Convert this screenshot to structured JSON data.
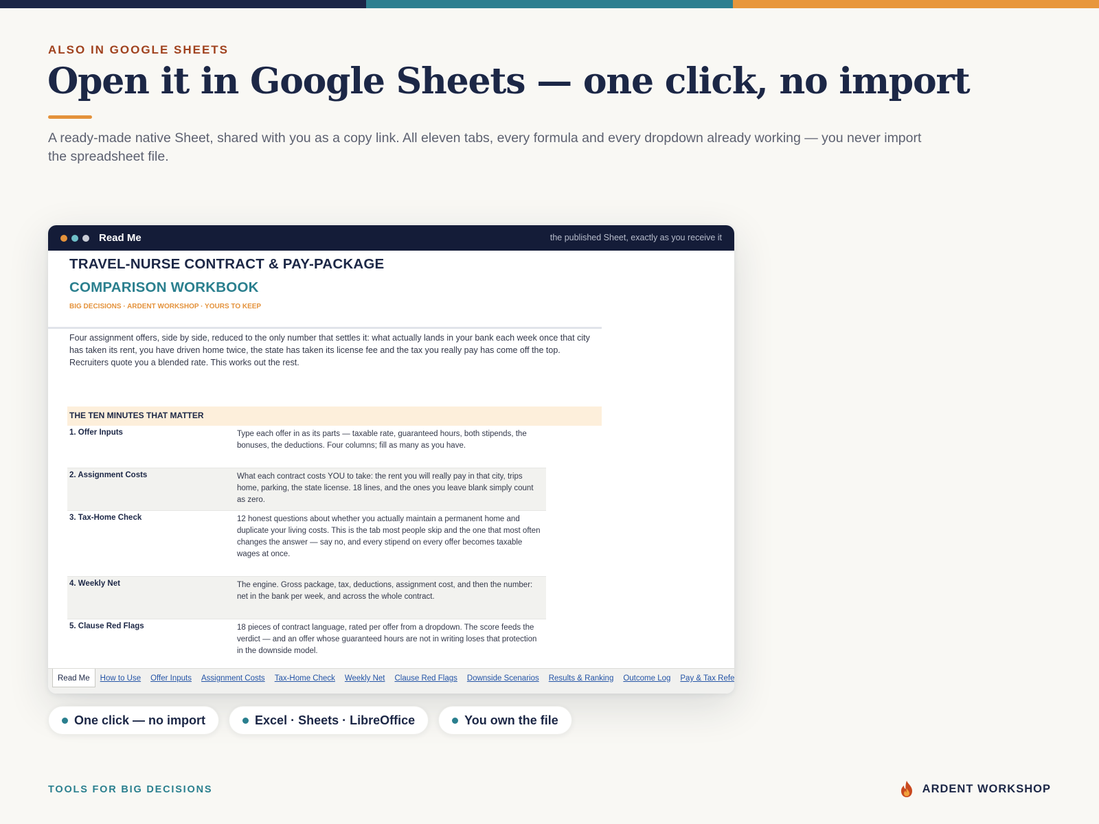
{
  "colors": {
    "navy": "#1c2746",
    "teal": "#2a7f8e",
    "orange": "#e4923b",
    "rust": "#a0421e",
    "background": "#f9f8f4"
  },
  "topbar": {
    "colors": [
      "#1b2647",
      "#2e8090",
      "#e8973c"
    ]
  },
  "header": {
    "eyebrow": "ALSO IN GOOGLE SHEETS",
    "headline": "Open it in Google Sheets — one click, no import",
    "subhead": "A ready-made native Sheet, shared with you as a copy link. All eleven tabs, every formula and every dropdown already working — you never import the spreadsheet file."
  },
  "window": {
    "dots": [
      "#e4923b",
      "#6ebfc9",
      "#c9ccd6"
    ],
    "title": "Read Me",
    "note": "the published Sheet, exactly as you receive it"
  },
  "sheet": {
    "title_line1": "TRAVEL-NURSE CONTRACT & PAY-PACKAGE",
    "title_line2": "COMPARISON WORKBOOK",
    "tagline": "BIG DECISIONS · ARDENT WORKSHOP · YOURS TO KEEP",
    "intro": "Four assignment offers, side by side, reduced to the only number that settles it: what actually lands in your bank each week once that city has taken its rent, you have driven home twice, the state has taken its license fee and the tax you really pay has come off the top. Recruiters quote you a blended rate. This works out the rest.",
    "section_header": "THE TEN MINUTES THAT MATTER",
    "rows": [
      {
        "label": "1. Offer Inputs",
        "text": "Type each offer in as its parts — taxable rate, guaranteed hours, both stipends, the bonuses, the deductions. Four columns; fill as many as you have."
      },
      {
        "label": "2. Assignment Costs",
        "text": "What each contract costs YOU to take: the rent you will really pay in that city, trips home, parking, the state license. 18 lines, and the ones you leave blank simply count as zero."
      },
      {
        "label": "3. Tax-Home Check",
        "text": "12 honest questions about whether you actually maintain a permanent home and duplicate your living costs. This is the tab most people skip and the one that most often changes the answer — say no, and every stipend on every offer becomes taxable wages at once."
      },
      {
        "label": "4. Weekly Net",
        "text": "The engine. Gross package, tax, deductions, assignment cost, and then the number: net in the bank per week, and across the whole contract."
      },
      {
        "label": "5. Clause Red Flags",
        "text": "18 pieces of contract language, rated per offer from a dropdown. The score feeds the verdict — and an offer whose guaranteed hours are not in writing loses that protection in the downside model."
      }
    ],
    "tabs": [
      "Read Me",
      "How to Use",
      "Offer Inputs",
      "Assignment Costs",
      "Tax-Home Check",
      "Weekly Net",
      "Clause Red Flags",
      "Downside Scenarios",
      "Results & Ranking",
      "Outcome Log",
      "Pay & Tax Reference"
    ]
  },
  "pills": [
    "One click — no import",
    "Excel · Sheets · LibreOffice",
    "You own the file"
  ],
  "footer": {
    "left": "TOOLS FOR BIG DECISIONS",
    "brand": "ARDENT WORKSHOP",
    "brand_icon": "flame-logo-icon"
  }
}
